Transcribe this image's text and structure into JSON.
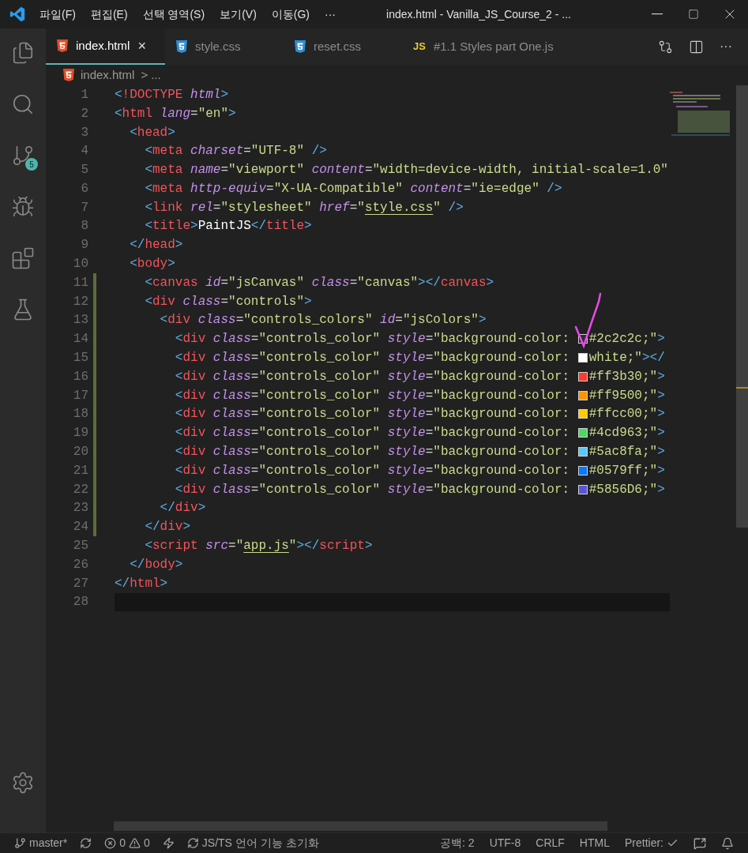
{
  "menu": [
    "파일(F)",
    "편집(E)",
    "선택 영역(S)",
    "보기(V)",
    "이동(G)",
    "···"
  ],
  "window_title": "index.html - Vanilla_JS_Course_2 - ...",
  "activity_bar": {
    "source_control_badge": "5"
  },
  "tabs": [
    {
      "kind": "html",
      "label": "index.html",
      "selected": true,
      "close": "×"
    },
    {
      "kind": "css",
      "label": "style.css",
      "selected": false
    },
    {
      "kind": "css",
      "label": "reset.css",
      "selected": false
    },
    {
      "kind": "js",
      "badge": "JS",
      "label": "#1.1 Styles part One.js",
      "selected": false
    }
  ],
  "editor_actions": {
    "more": "···"
  },
  "breadcrumb": {
    "file": "index.html",
    "separator": ">",
    "rest": "..."
  },
  "lines": [
    {
      "number": "1",
      "modified": false,
      "current": false,
      "tokens": [
        {
          "kind": "bracket",
          "text": "<"
        },
        {
          "kind": "tag",
          "text": "!DOCTYPE"
        },
        {
          "kind": "attr",
          "text": " html"
        },
        {
          "kind": "bracket",
          "text": ">"
        }
      ]
    },
    {
      "number": "2",
      "modified": false,
      "current": false,
      "tokens": [
        {
          "kind": "bracket",
          "text": "<"
        },
        {
          "kind": "tag",
          "text": "html"
        },
        {
          "kind": "attr",
          "text": " lang"
        },
        {
          "kind": "eq",
          "text": "="
        },
        {
          "kind": "string",
          "text": "\"en\""
        },
        {
          "kind": "bracket",
          "text": ">"
        }
      ]
    },
    {
      "number": "3",
      "modified": false,
      "current": false,
      "tokens": [
        {
          "kind": "bracket",
          "text": "  <"
        },
        {
          "kind": "tag",
          "text": "head"
        },
        {
          "kind": "bracket",
          "text": ">"
        }
      ]
    },
    {
      "number": "4",
      "modified": false,
      "current": false,
      "tokens": [
        {
          "kind": "bracket",
          "text": "    <"
        },
        {
          "kind": "tag",
          "text": "meta"
        },
        {
          "kind": "attr",
          "text": " charset"
        },
        {
          "kind": "eq",
          "text": "="
        },
        {
          "kind": "string",
          "text": "\"UTF-8\""
        },
        {
          "kind": "bracket",
          "text": " />"
        }
      ]
    },
    {
      "number": "5",
      "modified": false,
      "current": false,
      "tokens": [
        {
          "kind": "bracket",
          "text": "    <"
        },
        {
          "kind": "tag",
          "text": "meta"
        },
        {
          "kind": "attr",
          "text": " name"
        },
        {
          "kind": "eq",
          "text": "="
        },
        {
          "kind": "string",
          "text": "\"viewport\""
        },
        {
          "kind": "attr",
          "text": " content"
        },
        {
          "kind": "eq",
          "text": "="
        },
        {
          "kind": "string",
          "text": "\"width=device-width, initial-scale=1.0\""
        }
      ]
    },
    {
      "number": "6",
      "modified": false,
      "current": false,
      "tokens": [
        {
          "kind": "bracket",
          "text": "    <"
        },
        {
          "kind": "tag",
          "text": "meta"
        },
        {
          "kind": "attr",
          "text": " http-equiv"
        },
        {
          "kind": "eq",
          "text": "="
        },
        {
          "kind": "string",
          "text": "\"X-UA-Compatible\""
        },
        {
          "kind": "attr",
          "text": " content"
        },
        {
          "kind": "eq",
          "text": "="
        },
        {
          "kind": "string",
          "text": "\"ie=edge\""
        },
        {
          "kind": "bracket",
          "text": " />"
        }
      ]
    },
    {
      "number": "7",
      "modified": false,
      "current": false,
      "tokens": [
        {
          "kind": "bracket",
          "text": "    <"
        },
        {
          "kind": "tag",
          "text": "link"
        },
        {
          "kind": "attr",
          "text": " rel"
        },
        {
          "kind": "eq",
          "text": "="
        },
        {
          "kind": "string",
          "text": "\"stylesheet\""
        },
        {
          "kind": "attr",
          "text": " href"
        },
        {
          "kind": "eq",
          "text": "="
        },
        {
          "kind": "string",
          "text": "\""
        },
        {
          "kind": "link",
          "text": "style.css"
        },
        {
          "kind": "string",
          "text": "\""
        },
        {
          "kind": "bracket",
          "text": " />"
        }
      ]
    },
    {
      "number": "8",
      "modified": false,
      "current": false,
      "tokens": [
        {
          "kind": "bracket",
          "text": "    <"
        },
        {
          "kind": "tag",
          "text": "title"
        },
        {
          "kind": "bracket",
          "text": ">"
        },
        {
          "kind": "plain",
          "text": "PaintJS"
        },
        {
          "kind": "bracket",
          "text": "</"
        },
        {
          "kind": "tag",
          "text": "title"
        },
        {
          "kind": "bracket",
          "text": ">"
        }
      ]
    },
    {
      "number": "9",
      "modified": false,
      "current": false,
      "tokens": [
        {
          "kind": "bracket",
          "text": "  </"
        },
        {
          "kind": "tag",
          "text": "head"
        },
        {
          "kind": "bracket",
          "text": ">"
        }
      ]
    },
    {
      "number": "10",
      "modified": false,
      "current": false,
      "tokens": [
        {
          "kind": "bracket",
          "text": "  <"
        },
        {
          "kind": "tag",
          "text": "body"
        },
        {
          "kind": "bracket",
          "text": ">"
        }
      ]
    },
    {
      "number": "11",
      "modified": true,
      "current": false,
      "tokens": [
        {
          "kind": "bracket",
          "text": "    <"
        },
        {
          "kind": "tag",
          "text": "canvas"
        },
        {
          "kind": "attr",
          "text": " id"
        },
        {
          "kind": "eq",
          "text": "="
        },
        {
          "kind": "string",
          "text": "\"jsCanvas\""
        },
        {
          "kind": "attr",
          "text": " class"
        },
        {
          "kind": "eq",
          "text": "="
        },
        {
          "kind": "string",
          "text": "\"canvas\""
        },
        {
          "kind": "bracket",
          "text": "></"
        },
        {
          "kind": "tag",
          "text": "canvas"
        },
        {
          "kind": "bracket",
          "text": ">"
        }
      ]
    },
    {
      "number": "12",
      "modified": true,
      "current": false,
      "tokens": [
        {
          "kind": "bracket",
          "text": "    <"
        },
        {
          "kind": "tag",
          "text": "div"
        },
        {
          "kind": "attr",
          "text": " class"
        },
        {
          "kind": "eq",
          "text": "="
        },
        {
          "kind": "string",
          "text": "\"controls\""
        },
        {
          "kind": "bracket",
          "text": ">"
        }
      ]
    },
    {
      "number": "13",
      "modified": true,
      "current": false,
      "tokens": [
        {
          "kind": "bracket",
          "text": "      <"
        },
        {
          "kind": "tag",
          "text": "div"
        },
        {
          "kind": "attr",
          "text": " class"
        },
        {
          "kind": "eq",
          "text": "="
        },
        {
          "kind": "string",
          "text": "\"controls_colors\""
        },
        {
          "kind": "attr",
          "text": " id"
        },
        {
          "kind": "eq",
          "text": "="
        },
        {
          "kind": "string",
          "text": "\"jsColors\""
        },
        {
          "kind": "bracket",
          "text": ">"
        }
      ]
    },
    {
      "number": "14",
      "modified": true,
      "current": false,
      "tokens": [
        {
          "kind": "bracket",
          "text": "        <"
        },
        {
          "kind": "tag",
          "text": "div"
        },
        {
          "kind": "attr",
          "text": " class"
        },
        {
          "kind": "eq",
          "text": "="
        },
        {
          "kind": "string",
          "text": "\"controls_color\""
        },
        {
          "kind": "attr",
          "text": " style"
        },
        {
          "kind": "eq",
          "text": "="
        },
        {
          "kind": "string",
          "text": "\"background-color: "
        },
        {
          "kind": "swatch",
          "color": "#2c2c2c"
        },
        {
          "kind": "string",
          "text": "#2c2c2c;\""
        },
        {
          "kind": "bracket",
          "text": ">"
        }
      ]
    },
    {
      "number": "15",
      "modified": true,
      "current": false,
      "tokens": [
        {
          "kind": "bracket",
          "text": "        <"
        },
        {
          "kind": "tag",
          "text": "div"
        },
        {
          "kind": "attr",
          "text": " class"
        },
        {
          "kind": "eq",
          "text": "="
        },
        {
          "kind": "string",
          "text": "\"controls_color\""
        },
        {
          "kind": "attr",
          "text": " style"
        },
        {
          "kind": "eq",
          "text": "="
        },
        {
          "kind": "string",
          "text": "\"background-color: "
        },
        {
          "kind": "swatch",
          "color": "#ffffff"
        },
        {
          "kind": "string",
          "text": "white;\""
        },
        {
          "kind": "bracket",
          "text": "></"
        }
      ]
    },
    {
      "number": "16",
      "modified": true,
      "current": false,
      "tokens": [
        {
          "kind": "bracket",
          "text": "        <"
        },
        {
          "kind": "tag",
          "text": "div"
        },
        {
          "kind": "attr",
          "text": " class"
        },
        {
          "kind": "eq",
          "text": "="
        },
        {
          "kind": "string",
          "text": "\"controls_color\""
        },
        {
          "kind": "attr",
          "text": " style"
        },
        {
          "kind": "eq",
          "text": "="
        },
        {
          "kind": "string",
          "text": "\"background-color: "
        },
        {
          "kind": "swatch",
          "color": "#ff3b30"
        },
        {
          "kind": "string",
          "text": "#ff3b30;\""
        },
        {
          "kind": "bracket",
          "text": ">"
        }
      ]
    },
    {
      "number": "17",
      "modified": true,
      "current": false,
      "tokens": [
        {
          "kind": "bracket",
          "text": "        <"
        },
        {
          "kind": "tag",
          "text": "div"
        },
        {
          "kind": "attr",
          "text": " class"
        },
        {
          "kind": "eq",
          "text": "="
        },
        {
          "kind": "string",
          "text": "\"controls_color\""
        },
        {
          "kind": "attr",
          "text": " style"
        },
        {
          "kind": "eq",
          "text": "="
        },
        {
          "kind": "string",
          "text": "\"background-color: "
        },
        {
          "kind": "swatch",
          "color": "#ff9500"
        },
        {
          "kind": "string",
          "text": "#ff9500;\""
        },
        {
          "kind": "bracket",
          "text": ">"
        }
      ]
    },
    {
      "number": "18",
      "modified": true,
      "current": false,
      "tokens": [
        {
          "kind": "bracket",
          "text": "        <"
        },
        {
          "kind": "tag",
          "text": "div"
        },
        {
          "kind": "attr",
          "text": " class"
        },
        {
          "kind": "eq",
          "text": "="
        },
        {
          "kind": "string",
          "text": "\"controls_color\""
        },
        {
          "kind": "attr",
          "text": " style"
        },
        {
          "kind": "eq",
          "text": "="
        },
        {
          "kind": "string",
          "text": "\"background-color: "
        },
        {
          "kind": "swatch",
          "color": "#ffcc00"
        },
        {
          "kind": "string",
          "text": "#ffcc00;\""
        },
        {
          "kind": "bracket",
          "text": ">"
        }
      ]
    },
    {
      "number": "19",
      "modified": true,
      "current": false,
      "tokens": [
        {
          "kind": "bracket",
          "text": "        <"
        },
        {
          "kind": "tag",
          "text": "div"
        },
        {
          "kind": "attr",
          "text": " class"
        },
        {
          "kind": "eq",
          "text": "="
        },
        {
          "kind": "string",
          "text": "\"controls_color\""
        },
        {
          "kind": "attr",
          "text": " style"
        },
        {
          "kind": "eq",
          "text": "="
        },
        {
          "kind": "string",
          "text": "\"background-color: "
        },
        {
          "kind": "swatch",
          "color": "#4cd963"
        },
        {
          "kind": "string",
          "text": "#4cd963;\""
        },
        {
          "kind": "bracket",
          "text": ">"
        }
      ]
    },
    {
      "number": "20",
      "modified": true,
      "current": false,
      "tokens": [
        {
          "kind": "bracket",
          "text": "        <"
        },
        {
          "kind": "tag",
          "text": "div"
        },
        {
          "kind": "attr",
          "text": " class"
        },
        {
          "kind": "eq",
          "text": "="
        },
        {
          "kind": "string",
          "text": "\"controls_color\""
        },
        {
          "kind": "attr",
          "text": " style"
        },
        {
          "kind": "eq",
          "text": "="
        },
        {
          "kind": "string",
          "text": "\"background-color: "
        },
        {
          "kind": "swatch",
          "color": "#5ac8fa"
        },
        {
          "kind": "string",
          "text": "#5ac8fa;\""
        },
        {
          "kind": "bracket",
          "text": ">"
        }
      ]
    },
    {
      "number": "21",
      "modified": true,
      "current": false,
      "tokens": [
        {
          "kind": "bracket",
          "text": "        <"
        },
        {
          "kind": "tag",
          "text": "div"
        },
        {
          "kind": "attr",
          "text": " class"
        },
        {
          "kind": "eq",
          "text": "="
        },
        {
          "kind": "string",
          "text": "\"controls_color\""
        },
        {
          "kind": "attr",
          "text": " style"
        },
        {
          "kind": "eq",
          "text": "="
        },
        {
          "kind": "string",
          "text": "\"background-color: "
        },
        {
          "kind": "swatch",
          "color": "#0579ff"
        },
        {
          "kind": "string",
          "text": "#0579ff;\""
        },
        {
          "kind": "bracket",
          "text": ">"
        }
      ]
    },
    {
      "number": "22",
      "modified": true,
      "current": false,
      "tokens": [
        {
          "kind": "bracket",
          "text": "        <"
        },
        {
          "kind": "tag",
          "text": "div"
        },
        {
          "kind": "attr",
          "text": " class"
        },
        {
          "kind": "eq",
          "text": "="
        },
        {
          "kind": "string",
          "text": "\"controls_color\""
        },
        {
          "kind": "attr",
          "text": " style"
        },
        {
          "kind": "eq",
          "text": "="
        },
        {
          "kind": "string",
          "text": "\"background-color: "
        },
        {
          "kind": "swatch",
          "color": "#5856d6"
        },
        {
          "kind": "string",
          "text": "#5856D6;\""
        },
        {
          "kind": "bracket",
          "text": ">"
        }
      ]
    },
    {
      "number": "23",
      "modified": true,
      "current": false,
      "tokens": [
        {
          "kind": "bracket",
          "text": "      </"
        },
        {
          "kind": "tag",
          "text": "div"
        },
        {
          "kind": "bracket",
          "text": ">"
        }
      ]
    },
    {
      "number": "24",
      "modified": true,
      "current": false,
      "tokens": [
        {
          "kind": "bracket",
          "text": "    </"
        },
        {
          "kind": "tag",
          "text": "div"
        },
        {
          "kind": "bracket",
          "text": ">"
        }
      ]
    },
    {
      "number": "25",
      "modified": false,
      "current": false,
      "tokens": [
        {
          "kind": "bracket",
          "text": "    <"
        },
        {
          "kind": "tag",
          "text": "script"
        },
        {
          "kind": "attr",
          "text": " src"
        },
        {
          "kind": "eq",
          "text": "="
        },
        {
          "kind": "string",
          "text": "\""
        },
        {
          "kind": "link",
          "text": "app.js"
        },
        {
          "kind": "string",
          "text": "\""
        },
        {
          "kind": "bracket",
          "text": "></"
        },
        {
          "kind": "tag",
          "text": "script"
        },
        {
          "kind": "bracket",
          "text": ">"
        }
      ]
    },
    {
      "number": "26",
      "modified": false,
      "current": false,
      "tokens": [
        {
          "kind": "bracket",
          "text": "  </"
        },
        {
          "kind": "tag",
          "text": "body"
        },
        {
          "kind": "bracket",
          "text": ">"
        }
      ]
    },
    {
      "number": "27",
      "modified": false,
      "current": false,
      "tokens": [
        {
          "kind": "bracket",
          "text": "</"
        },
        {
          "kind": "tag",
          "text": "html"
        },
        {
          "kind": "bracket",
          "text": ">"
        }
      ]
    },
    {
      "number": "28",
      "modified": false,
      "current": true
    }
  ],
  "status_bar": {
    "branch": "master*",
    "errors": "0",
    "warnings": "0",
    "task": "JS/TS 언어 기능 초기화",
    "indent": "공백: 2",
    "encoding": "UTF-8",
    "eol": "CRLF",
    "language": "HTML",
    "formatter": "Prettier:"
  }
}
